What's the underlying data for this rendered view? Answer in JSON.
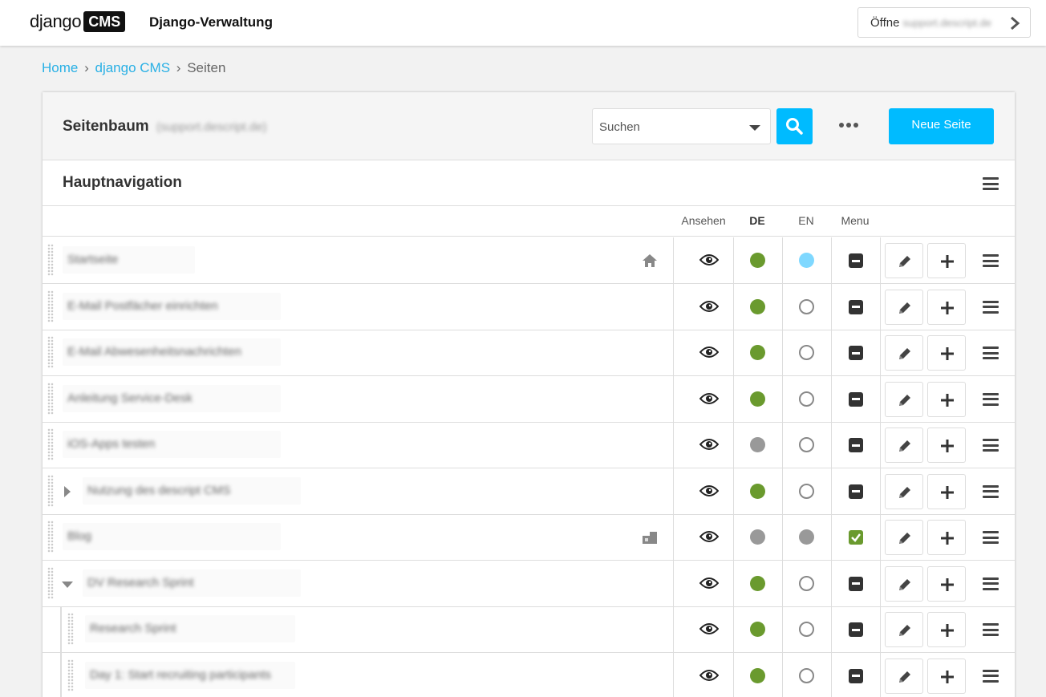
{
  "topbar": {
    "logo_text": "django",
    "logo_box": "CMS",
    "admin_title": "Django-Verwaltung",
    "open_label": "Öffne",
    "open_url": "support.descript.de"
  },
  "breadcrumb": {
    "home": "Home",
    "cms": "django CMS",
    "current": "Seiten",
    "separator": "›"
  },
  "panel": {
    "title": "Seitenbaum",
    "site": "(support.descript.de)",
    "search_placeholder": "Suchen",
    "new_page_label": "Neue Seite"
  },
  "navigation": {
    "title": "Hauptnavigation"
  },
  "columns": {
    "view": "Ansehen",
    "de": "DE",
    "en": "EN",
    "menu": "Menu"
  },
  "colors": {
    "accent": "#00bbff",
    "link": "#29b0e5",
    "published": "#6a9a2e",
    "unpublished": "#999999",
    "en_draft": "#7fd8ff"
  },
  "rows": [
    {
      "title": "Startseite",
      "de": "green",
      "en": "lightblue",
      "menu": "minus",
      "icon": "home-icon",
      "expander": "",
      "child": false
    },
    {
      "title": "E-Mail Postfächer einrichten",
      "de": "green",
      "en": "empty",
      "menu": "minus",
      "icon": "",
      "expander": "",
      "child": false
    },
    {
      "title": "E-Mail Abwesenheitsnachrichten",
      "de": "green",
      "en": "empty",
      "menu": "minus",
      "icon": "",
      "expander": "",
      "child": false
    },
    {
      "title": "Anleitung Service-Desk",
      "de": "green",
      "en": "empty",
      "menu": "minus",
      "icon": "",
      "expander": "",
      "child": false
    },
    {
      "title": "iOS-Apps testen",
      "de": "grey",
      "en": "empty",
      "menu": "minus",
      "icon": "",
      "expander": "",
      "child": false
    },
    {
      "title": "Nutzung des descript CMS",
      "de": "green",
      "en": "empty",
      "menu": "minus",
      "icon": "",
      "expander": "right",
      "child": false
    },
    {
      "title": "Blog",
      "de": "grey",
      "en": "grey",
      "menu": "check",
      "icon": "apphook-icon",
      "expander": "",
      "child": false
    },
    {
      "title": "DV Research Sprint",
      "de": "green",
      "en": "empty",
      "menu": "minus",
      "icon": "",
      "expander": "down",
      "child": false
    },
    {
      "title": "Research Sprint",
      "de": "green",
      "en": "empty",
      "menu": "minus",
      "icon": "",
      "expander": "",
      "child": true
    },
    {
      "title": "Day 1: Start recruiting participants",
      "de": "green",
      "en": "empty",
      "menu": "minus",
      "icon": "",
      "expander": "",
      "child": true
    }
  ]
}
